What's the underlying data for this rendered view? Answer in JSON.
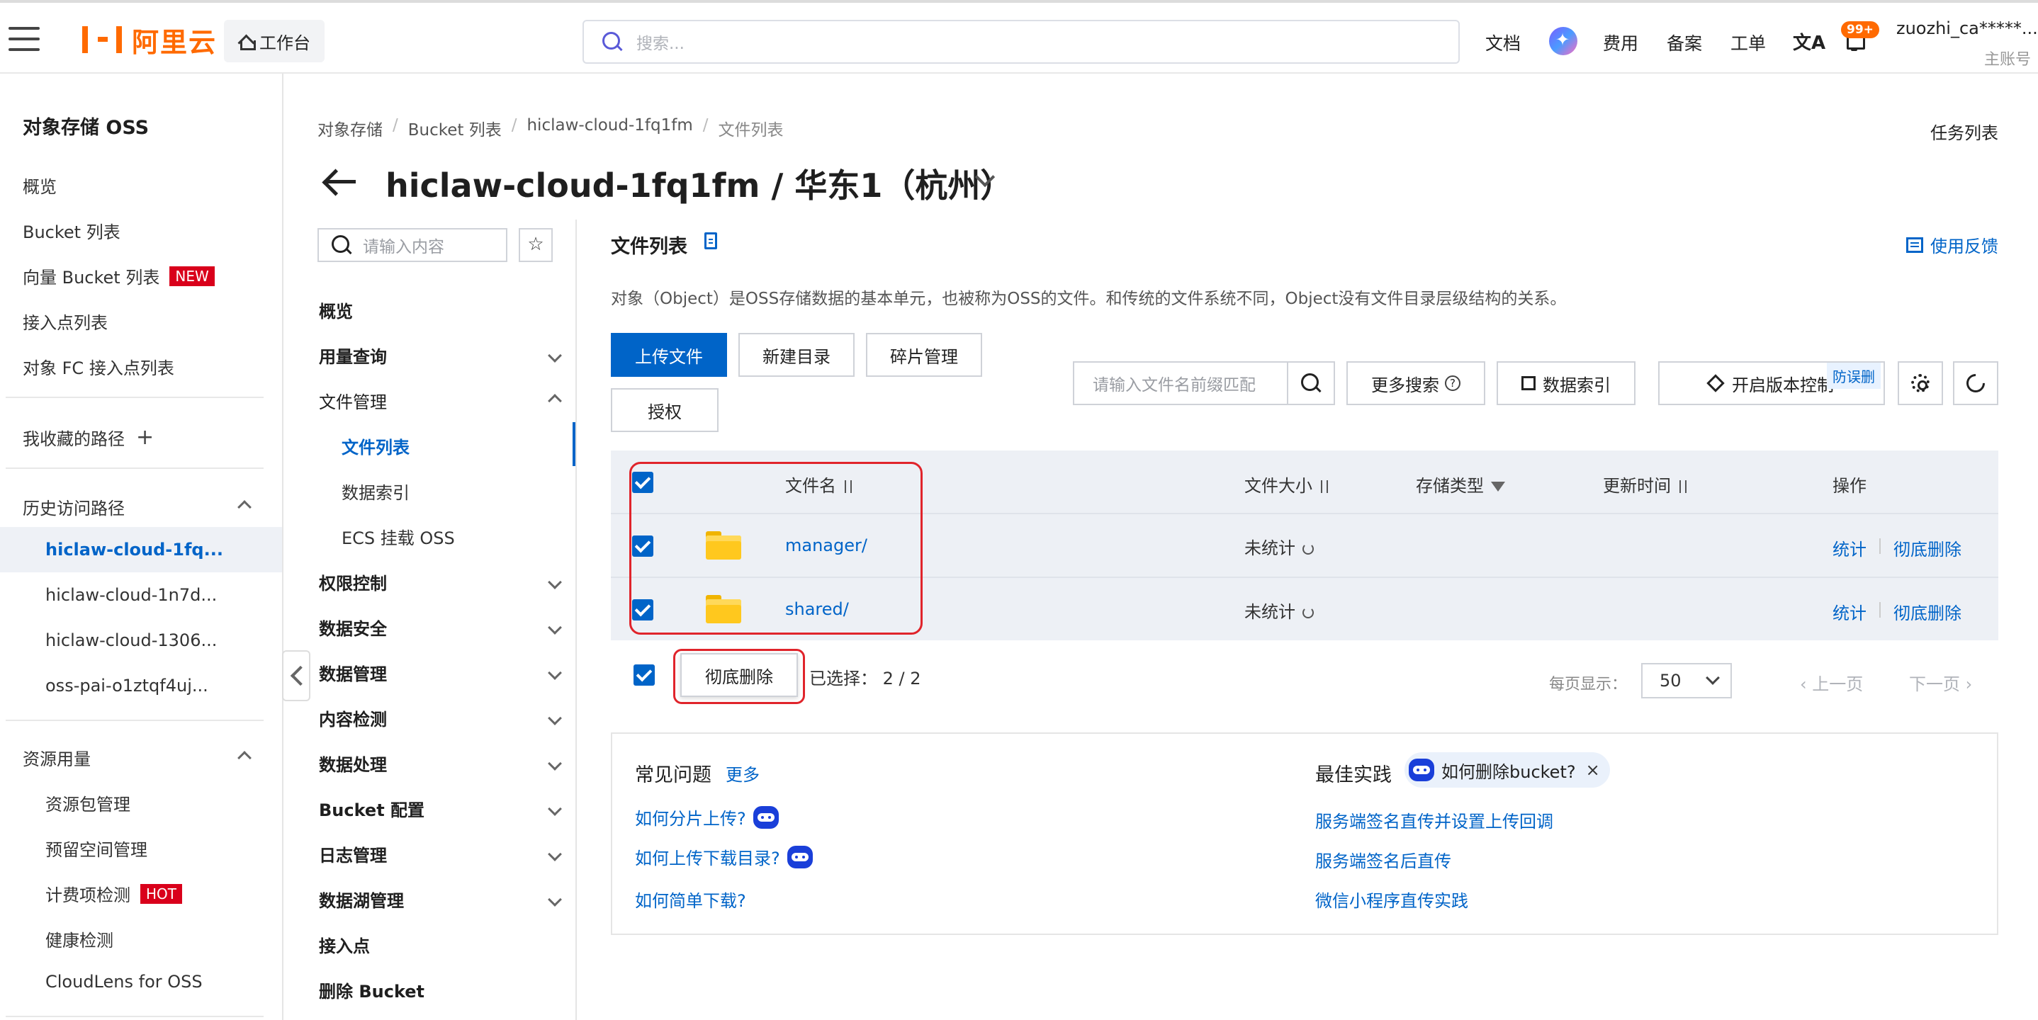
{
  "topbar": {
    "brand": "阿里云",
    "workbench": "工作台",
    "search_placeholder": "搜索...",
    "docs": "文档",
    "fees": "费用",
    "beian": "备案",
    "ticket": "工单",
    "lang_icon": "文A",
    "notification_badge": "99+",
    "username": "zuozhi_ca*****...",
    "account_type": "主账号"
  },
  "sidebar": {
    "title": "对象存储 OSS",
    "items": [
      "概览",
      "Bucket 列表",
      "向量 Bucket 列表",
      "接入点列表",
      "对象 FC 接入点列表"
    ],
    "new_tag": "NEW",
    "favorites": "我收藏的路径",
    "history_title": "历史访问路径",
    "history": [
      "hiclaw-cloud-1fq...",
      "hiclaw-cloud-1n7d...",
      "hiclaw-cloud-1306...",
      "oss-pai-o1ztqf4uj..."
    ],
    "resource_title": "资源用量",
    "resources": [
      "资源包管理",
      "预留空间管理",
      "计费项检测",
      "健康检测",
      "CloudLens for OSS"
    ],
    "hot_tag": "HOT"
  },
  "breadcrumb": [
    "对象存储",
    "Bucket 列表",
    "hiclaw-cloud-1fq1fm",
    "文件列表"
  ],
  "task_list": "任务列表",
  "page_title": "hiclaw-cloud-1fq1fm / 华东1（杭州）",
  "secnav": {
    "search_placeholder": "请输入内容",
    "star": "☆",
    "overview": "概览",
    "usage": "用量查询",
    "file_mgmt": "文件管理",
    "file_list": "文件列表",
    "data_index": "数据索引",
    "ecs_mount": "ECS 挂载 OSS",
    "permission": "权限控制",
    "data_security": "数据安全",
    "data_mgmt": "数据管理",
    "content_check": "内容检测",
    "data_processing": "数据处理",
    "bucket_config": "Bucket 配置",
    "log_mgmt": "日志管理",
    "datalake": "数据湖管理",
    "access_point": "接入点",
    "delete_bucket": "删除 Bucket"
  },
  "content": {
    "title": "文件列表",
    "feedback": "使用反馈",
    "description": "对象（Object）是OSS存储数据的基本单元，也被称为OSS的文件。和传统的文件系统不同，Object没有文件目录层级结构的关系。",
    "buttons": {
      "upload": "上传文件",
      "new_dir": "新建目录",
      "fragments": "碎片管理",
      "authorize": "授权",
      "more_search": "更多搜索",
      "data_index": "数据索引",
      "versioning": "开启版本控制",
      "anti_delete": "防误删"
    },
    "file_search_placeholder": "请输入文件名前缀匹配"
  },
  "table": {
    "headers": {
      "name": "文件名",
      "size": "文件大小",
      "storage": "存储类型",
      "updated": "更新时间",
      "ops": "操作"
    },
    "rows": [
      {
        "name": "manager/",
        "size": "未统计",
        "op1": "统计",
        "op2": "彻底删除"
      },
      {
        "name": "shared/",
        "size": "未统计",
        "op1": "统计",
        "op2": "彻底删除"
      }
    ]
  },
  "footer": {
    "delete_btn": "彻底删除",
    "selected_label": "已选择：",
    "selected_value": "2 / 2",
    "per_page_label": "每页显示：",
    "per_page_value": "50",
    "prev": "上一页",
    "next": "下一页"
  },
  "faq": {
    "title": "常见问题",
    "more": "更多",
    "links": [
      "如何分片上传?",
      "如何上传下载目录?",
      "如何简单下载?"
    ],
    "best_title": "最佳实践",
    "chip": "如何删除bucket?",
    "chip_close": "×",
    "best_links": [
      "服务端签名直传并设置上传回调",
      "服务端签名后直传",
      "微信小程序直传实践"
    ]
  }
}
